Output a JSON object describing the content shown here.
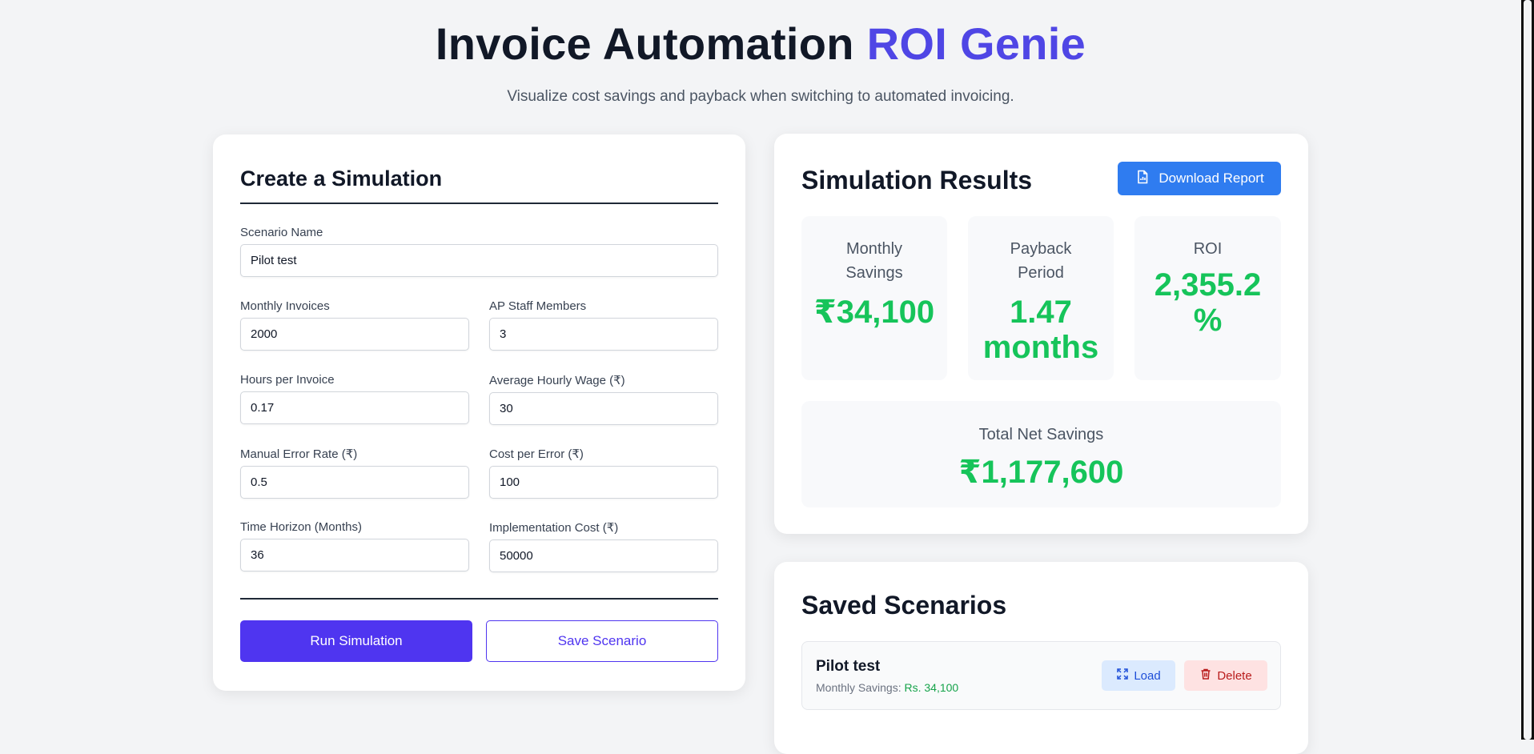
{
  "header": {
    "title_main": "Invoice Automation",
    "title_accent": "ROI Genie",
    "subtitle": "Visualize cost savings and payback when switching to automated invoicing."
  },
  "form": {
    "title": "Create a Simulation",
    "scenario_name": {
      "label": "Scenario Name",
      "value": "Pilot test"
    },
    "monthly_invoices": {
      "label": "Monthly Invoices",
      "value": "2000"
    },
    "ap_staff": {
      "label": "AP Staff Members",
      "value": "3"
    },
    "hours_per_invoice": {
      "label": "Hours per Invoice",
      "value": "0.17"
    },
    "hourly_wage": {
      "label": "Average Hourly Wage (₹)",
      "value": "30"
    },
    "error_rate": {
      "label": "Manual Error Rate (₹)",
      "value": "0.5"
    },
    "cost_per_error": {
      "label": "Cost per Error (₹)",
      "value": "100"
    },
    "time_horizon": {
      "label": "Time Horizon (Months)",
      "value": "36"
    },
    "implementation_cost": {
      "label": "Implementation Cost (₹)",
      "value": "50000"
    },
    "run_button": "Run Simulation",
    "save_button": "Save Scenario"
  },
  "results": {
    "title": "Simulation Results",
    "download_button": "Download Report",
    "monthly_savings": {
      "label_line1": "Monthly",
      "label_line2": "Savings",
      "value": "₹34,100"
    },
    "payback": {
      "label_line1": "Payback",
      "label_line2": "Period",
      "value_line1": "1.47",
      "value_line2": "months"
    },
    "roi": {
      "label": "ROI",
      "value_line1": "2,355.2",
      "value_line2": "%"
    },
    "total_net_savings": {
      "label": "Total Net Savings",
      "value": "₹1,177,600"
    }
  },
  "saved": {
    "title": "Saved Scenarios",
    "items": [
      {
        "name": "Pilot test",
        "meta_label": "Monthly Savings:",
        "meta_value": "Rs. 34,100",
        "load_label": "Load",
        "delete_label": "Delete"
      }
    ]
  },
  "colors": {
    "accent": "#4f46e5",
    "primary_button": "#4f35f0",
    "download_button": "#2f7cf0",
    "success": "#16c45a"
  },
  "icons": [
    "document-chart-icon",
    "load-icon",
    "trash-icon"
  ]
}
